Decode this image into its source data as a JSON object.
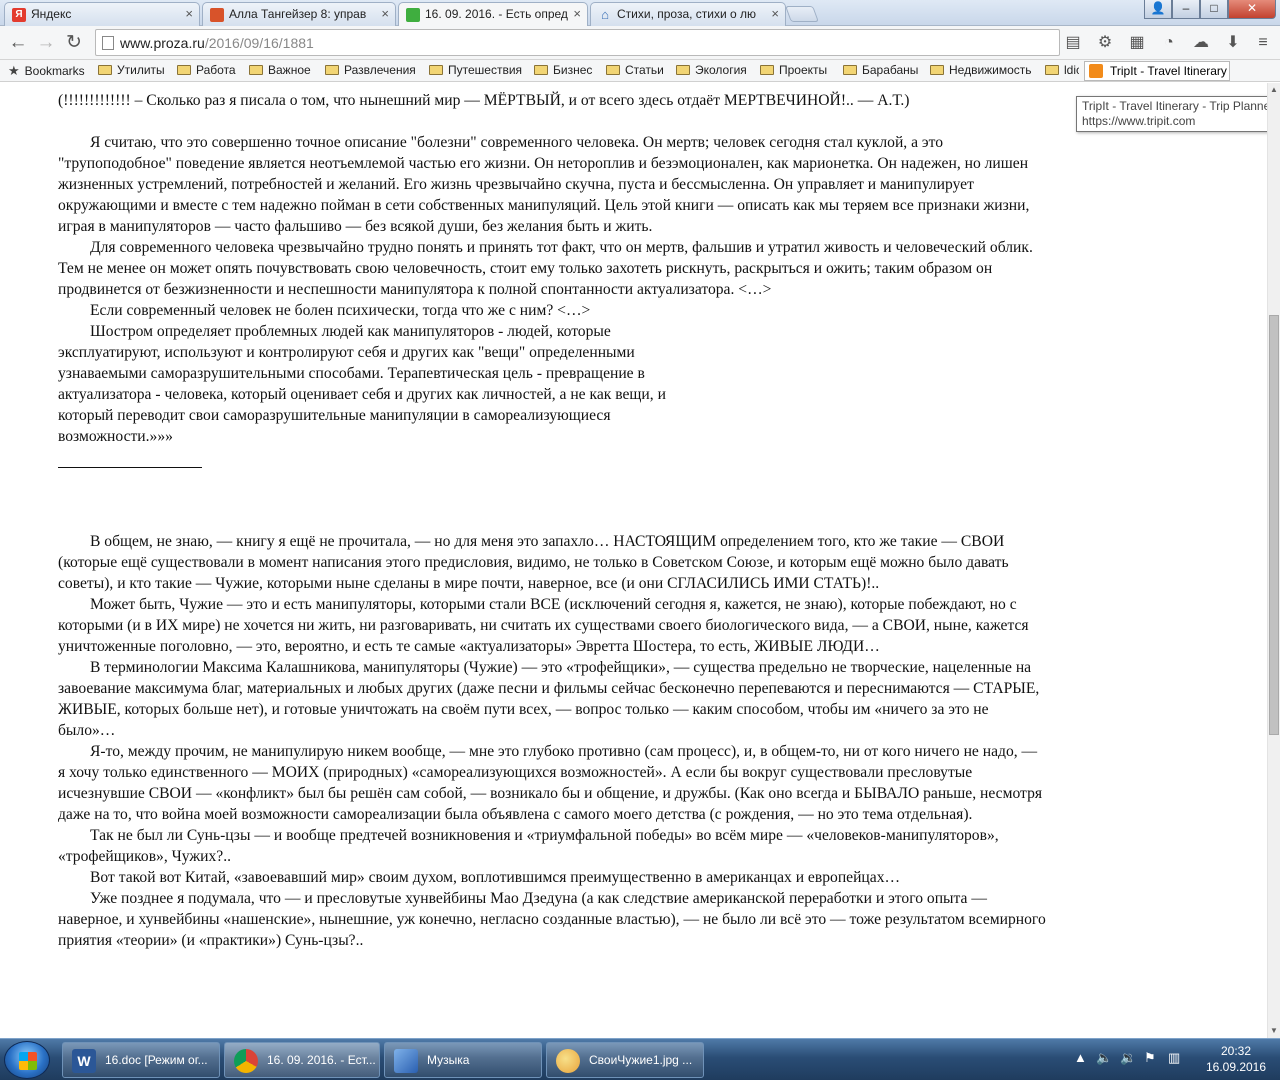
{
  "tabs": [
    {
      "title": "Яндекс",
      "icon": "yandex-icon",
      "color": "#e33b2e"
    },
    {
      "title": "Алла Тангейзер 8: управ",
      "icon": "proza-icon",
      "color": "#d8532a"
    },
    {
      "title": "16. 09. 2016. - Есть опред",
      "icon": "page-green-icon",
      "color": "#3fae3f"
    },
    {
      "title": "Стихи, проза, стихи о лю",
      "icon": "house-icon",
      "color": "#3a6fb5"
    }
  ],
  "toolbar": {
    "url_host": "www.proza.ru",
    "url_path": "/2016/09/16/1881"
  },
  "bookmarks": {
    "bookmarks_label": "Bookmarks",
    "folders": [
      "Утилиты",
      "Работа",
      "Важное",
      "Развлечения",
      "Путешествия",
      "Бизнес",
      "Статьи",
      "Экология",
      "Проекты",
      "Барабаны",
      "Недвижимость",
      "ldic"
    ],
    "tripit": "TripIt - Travel Itinerary"
  },
  "tooltip": {
    "title": "TripIt - Travel Itinerary - Trip Planner",
    "url": "https://www.tripit.com"
  },
  "article": {
    "intro": "(!!!!!!!!!!!!! – Сколько раз я писала о том, что нынешний мир — МЁРТВЫЙ, и от всего здесь отдаёт МЕРТВЕЧИНОЙ!.. — А.Т.)",
    "p1": "Я считаю, что это совершенно точное описание \"болезни\" современного человека. Он мертв; человек сегодня стал куклой, а это \"трупоподобное\" поведение является неотъемлемой частью его жизни. Он нетороплив и безэмоционален, как марионетка. Он надежен, но лишен жизненных устремлений, потребностей и желаний. Его жизнь чрезвычайно скучна, пуста и бессмысленна. Он управляет и манипулирует окружающими и вместе с тем надежно пойман в сети собственных манипуляций. Цель этой книги — описать как мы теряем все признаки жизни, играя в манипуляторов — часто фальшиво — без всякой души, без желания быть и жить.",
    "p2": "Для современного человека чрезвычайно трудно понять и принять тот факт, что он мертв, фальшив и утратил живость и человеческий облик. Тем не менее он может опять почувствовать свою человечность, стоит ему только захотеть рискнуть, раскрыться и ожить; таким образом он продвинется от безжизненности и неспешности манипулятора к полной спонтанности актуализатора. <…>",
    "p3": "Если современный человек не болен психически, тогда что же с ним? <…>",
    "p4": "Шостром определяет проблемных людей как манипуляторов - людей, которые эксплуатируют, используют и контролируют себя и других как \"вещи\" определенными узнаваемыми саморазрушительными способами. Терапевтическая цель - превращение в актуализатора - человека, который оценивает себя и других как личностей, а не как вещи, и который переводит свои саморазрушительные манипуляции в самореализующиеся возможности.»»»",
    "p5": "В общем, не знаю, — книгу я ещё не прочитала, — но для меня это запахло… НАСТОЯЩИМ определением того, кто же такие — СВОИ (которые ещё существовали в момент написания этого предисловия, видимо, не только в Советском Союзе, и которым ещё можно было давать советы), и кто такие — Чужие, которыми ныне сделаны в мире почти, наверное, все (и они СГЛАСИЛИСЬ ИМИ СТАТЬ)!..",
    "p6": "Может быть, Чужие — это и есть манипуляторы, которыми стали ВСЕ (исключений сегодня я, кажется, не знаю), которые побеждают, но с которыми (и в ИХ мире) не хочется ни жить, ни разговаривать, ни считать их существами своего биологического вида, — а СВОИ, ныне, кажется уничтоженные поголовно, — это, вероятно, и есть те самые «актуализаторы» Эвретта Шостера, то есть, ЖИВЫЕ ЛЮДИ…",
    "p7": "В терминологии Максима Калашникова, манипуляторы (Чужие) — это «трофейщики», — существа предельно не творческие, нацеленные на завоевание максимума благ, материальных и любых других (даже песни и фильмы сейчас бесконечно перепеваются и переснимаются — СТАРЫЕ, ЖИВЫЕ, которых больше нет), и готовые уничтожать на своём пути всех, — вопрос только — каким способом, чтобы им «ничего за это не было»…",
    "p8": "Я-то, между прочим, не манипулирую никем вообще, — мне это глубоко противно (сам процесс), и, в общем-то, ни от кого ничего не надо, — я хочу только единственного — МОИХ (природных) «самореализующихся возможностей». А если бы вокруг существовали пресловутые исчезнувшие СВОИ — «конфликт» был бы решён сам собой, — возникало бы и общение, и дружбы. (Как оно всегда и БЫВАЛО раньше, несмотря даже на то, что война моей возможности самореализации была объявлена с самого моего детства (с рождения, — но это тема отдельная).",
    "p9": "Так не был ли Сунь-цзы — и вообще предтечей возникновения и «триумфальной победы» во всём мире — «человеков-манипуляторов», «трофейщиков», Чужих?..",
    "p10": "Вот такой вот Китай, «завоевавший мир» своим духом, воплотившимся преимущественно в американцах и европейцах…",
    "p11": "Уже позднее я подумала, что — и пресловутые хунвейбины Мао Дзедуна (а как следствие американской переработки и этого опыта — наверное, и хунвейбины «нашенские», нынешние, уж конечно, негласно созданные властью), — не было ли всё это — тоже результатом всемирного приятия «теории» (и «практики») Сунь-цзы?.."
  },
  "taskbar": {
    "items": [
      {
        "label": "16.doc [Режим ог...",
        "icon": "word-icon",
        "color": "#2b5797"
      },
      {
        "label": "16. 09. 2016. - Ест...",
        "icon": "chrome-icon",
        "color": "#db4437"
      },
      {
        "label": "Музыка",
        "icon": "music-icon",
        "color": "#3b7dd8"
      },
      {
        "label": "СвоиЧужие1.jpg ...",
        "icon": "paint-icon",
        "color": "#e8a33a"
      }
    ],
    "time": "20:32",
    "date": "16.09.2016"
  }
}
